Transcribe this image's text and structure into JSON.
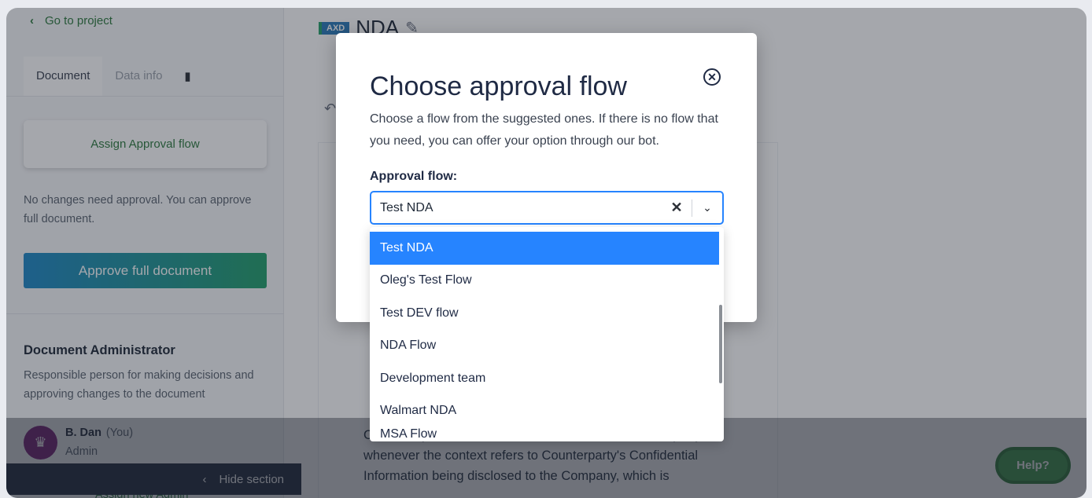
{
  "sidebar": {
    "back_label": "Go to project",
    "tabs": [
      {
        "label": "Document"
      },
      {
        "label": "Data info"
      }
    ],
    "assign_flow_label": "Assign Approval flow",
    "no_changes_text": "No changes need approval. You can approve full document.",
    "approve_label": "Approve full document",
    "admin_title": "Document Administrator",
    "admin_desc": "Responsible person for making decisions and approving changes to the document",
    "admin_name": "B. Dan",
    "admin_you": "(You)",
    "admin_role": "Admin",
    "assign_admin_label": "Assign new Admin",
    "hide_label": "Hide section"
  },
  "document": {
    "badge": "AXD",
    "title": "NDA",
    "body_lines": [
      "Conversely, the term “Discloser” shall refer to Counterparty",
      "whenever the context refers to Counterparty's Confidential",
      "Information being disclosed to the Company, which is"
    ]
  },
  "help_label": "Help?",
  "modal": {
    "title": "Choose approval flow",
    "description": "Choose a flow from the suggested ones. If there is no flow that you need, you can offer your option through our bot.",
    "field_label": "Approval flow:",
    "selected_value": "Test NDA",
    "options": [
      {
        "label": "Test NDA"
      },
      {
        "label": "Oleg's Test Flow"
      },
      {
        "label": "Test DEV flow"
      },
      {
        "label": "NDA Flow"
      },
      {
        "label": "Development team"
      },
      {
        "label": "Walmart NDA"
      },
      {
        "label": "MSA Flow"
      }
    ]
  },
  "colors": {
    "accent_green": "#2d7a3e",
    "select_blue": "#2684ff",
    "nav_dark": "#1f2a3c"
  },
  "icons": [
    "chevron-left-icon",
    "pencil-icon",
    "undo-icon",
    "close-circle-icon",
    "clear-x-icon",
    "chevron-down-icon",
    "crown-icon",
    "sidebar-toggle-icon"
  ]
}
